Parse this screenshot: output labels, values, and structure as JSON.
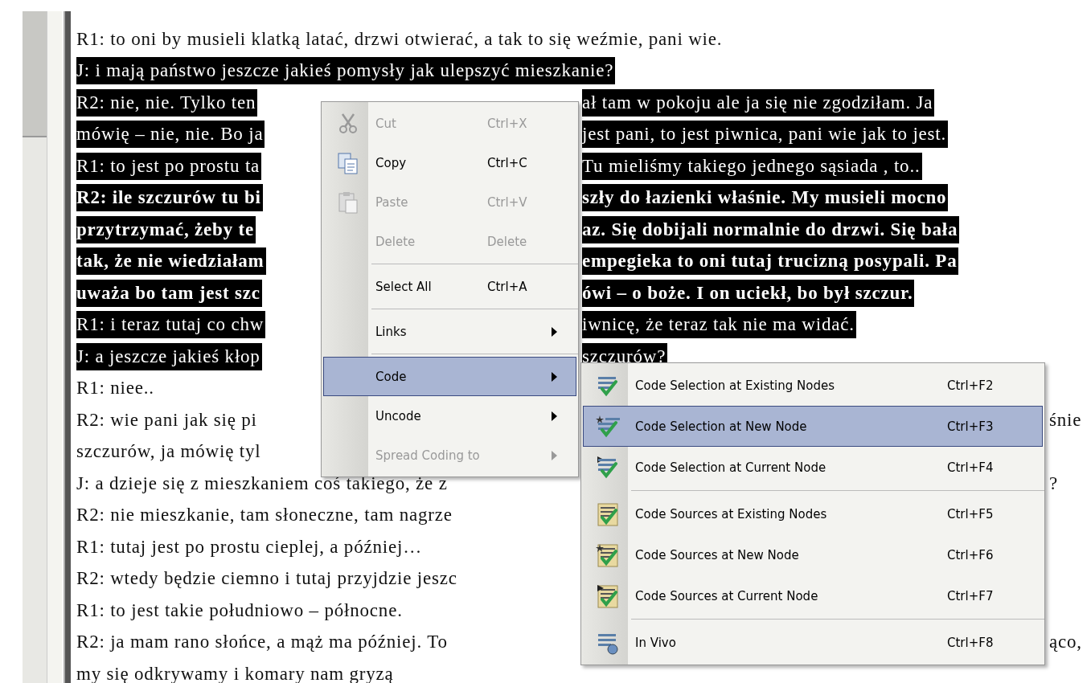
{
  "document": {
    "lines": [
      {
        "left": "R1: to oni by musieli klatką latać, drzwi otwierać, a tak to się weźmie, pani wie.",
        "selected": false,
        "bold": false
      },
      {
        "left": "J: i mają państwo jeszcze jakieś pomysły jak ulepszyć mieszkanie?",
        "selected": true,
        "bold": false
      },
      {
        "left": "R2: nie, nie. Tylko ten",
        "right": "ał tam w pokoju ale ja się nie zgodziłam. Ja",
        "selected": true,
        "bold": false
      },
      {
        "left": "mówię – nie, nie. Bo ja",
        "right": "jest pani, to jest piwnica, pani wie jak to jest.",
        "selected": true,
        "bold": false
      },
      {
        "left": "R1: to jest po prostu ta",
        "right": "Tu mieliśmy takiego jednego sąsiada , to..",
        "selected": true,
        "bold": false
      },
      {
        "left": "R2: ile szczurów tu bi",
        "right": "szły do łazienki właśnie. My musieli mocno",
        "selected": true,
        "bold": true
      },
      {
        "left": "przytrzymać, żeby te",
        "right": "az. Się dobijali normalnie do drzwi. Się bała",
        "selected": true,
        "bold": true
      },
      {
        "left": "tak, że nie wiedziałam",
        "right": "empegieka to oni tutaj trucizną posypali. Pa",
        "selected": true,
        "bold": true
      },
      {
        "left": "uważa bo tam jest szc",
        "right": "ówi – o boże. I on uciekł, bo był szczur.",
        "selected": true,
        "bold": true
      },
      {
        "left": "R1: i teraz tutaj co chw",
        "right": "iwnicę, że teraz tak nie ma widać.",
        "selected": true,
        "bold": false
      },
      {
        "left": "J: a jeszcze jakieś kłop",
        "right": "szczurów?",
        "selected": true,
        "bold": false
      },
      {
        "left": "R1: niee..",
        "selected": false,
        "bold": false
      },
      {
        "left": "R2: wie pani jak się pi",
        "right": "śnie",
        "selected": false,
        "bold": false
      },
      {
        "left": "szczurów, ja mówię tyl",
        "selected": false,
        "bold": false
      },
      {
        "left": "J: a dzieje się z mieszkaniem coś takiego, że z",
        "right": "?",
        "selected": false,
        "bold": false
      },
      {
        "left": "R2: nie mieszkanie, tam słoneczne, tam nagrze",
        "selected": false,
        "bold": false
      },
      {
        "left": "R1: tutaj jest po prostu cieplej, a później…",
        "selected": false,
        "bold": false
      },
      {
        "left": "R2: wtedy będzie ciemno i tutaj przyjdzie jeszc",
        "selected": false,
        "bold": false
      },
      {
        "left": "R1: to jest takie południowo – północne.",
        "selected": false,
        "bold": false
      },
      {
        "left": "R2: ja mam rano słońce, a mąż ma później. To",
        "right": "ąco,",
        "selected": false,
        "bold": false
      },
      {
        "left": "my się odkrywamy i komary nam gryzą",
        "selected": false,
        "bold": false
      }
    ]
  },
  "context_menu": {
    "items": [
      {
        "kind": "item",
        "label": "Cut",
        "shortcut": "Ctrl+X",
        "disabled": true,
        "selected": false
      },
      {
        "kind": "item",
        "label": "Copy",
        "shortcut": "Ctrl+C",
        "disabled": false,
        "selected": false
      },
      {
        "kind": "item",
        "label": "Paste",
        "shortcut": "Ctrl+V",
        "disabled": true,
        "selected": false
      },
      {
        "kind": "item",
        "label": "Delete",
        "shortcut": "Delete",
        "disabled": true,
        "selected": false
      },
      {
        "kind": "separator"
      },
      {
        "kind": "item",
        "label": "Select All",
        "shortcut": "Ctrl+A",
        "disabled": false,
        "selected": false
      },
      {
        "kind": "separator"
      },
      {
        "kind": "submenu",
        "label": "Links",
        "disabled": false,
        "selected": false
      },
      {
        "kind": "separator"
      },
      {
        "kind": "submenu",
        "label": "Code",
        "disabled": false,
        "selected": true
      },
      {
        "kind": "submenu",
        "label": "Uncode",
        "disabled": false,
        "selected": false
      },
      {
        "kind": "submenu",
        "label": "Spread Coding to",
        "disabled": true,
        "selected": false
      }
    ]
  },
  "submenu": {
    "items": [
      {
        "kind": "item",
        "label": "Code Selection at Existing Nodes",
        "shortcut": "Ctrl+F2",
        "selected": false
      },
      {
        "kind": "item",
        "label": "Code Selection at New Node",
        "shortcut": "Ctrl+F3",
        "selected": true
      },
      {
        "kind": "item",
        "label": "Code Selection at Current Node",
        "shortcut": "Ctrl+F4",
        "selected": false
      },
      {
        "kind": "separator"
      },
      {
        "kind": "item",
        "label": "Code Sources at Existing Nodes",
        "shortcut": "Ctrl+F5",
        "selected": false
      },
      {
        "kind": "item",
        "label": "Code Sources at New Node",
        "shortcut": "Ctrl+F6",
        "selected": false
      },
      {
        "kind": "item",
        "label": "Code Sources at Current Node",
        "shortcut": "Ctrl+F7",
        "selected": false
      },
      {
        "kind": "separator"
      },
      {
        "kind": "item",
        "label": "In Vivo",
        "shortcut": "Ctrl+F8",
        "selected": false
      }
    ]
  }
}
